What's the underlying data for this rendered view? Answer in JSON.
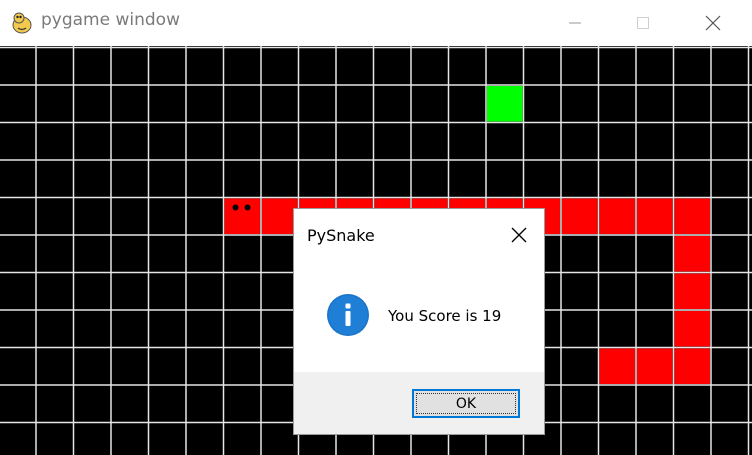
{
  "window": {
    "title": "pygame window",
    "icon": "pygame-snake-icon",
    "controls": [
      "minimize-icon",
      "maximize-icon",
      "close-icon"
    ]
  },
  "game": {
    "columns": 20,
    "rows": 11,
    "background": "#000000",
    "grid_color": "#e6e6e6",
    "snake_color": "#ff0000",
    "food_color": "#00ff00",
    "food": [
      13,
      1
    ],
    "snake_head": [
      6,
      4
    ],
    "snake_body": [
      [
        7,
        4
      ],
      [
        8,
        4
      ],
      [
        9,
        4
      ],
      [
        10,
        4
      ],
      [
        11,
        4
      ],
      [
        12,
        4
      ],
      [
        13,
        4
      ],
      [
        14,
        4
      ],
      [
        15,
        4
      ],
      [
        16,
        4
      ],
      [
        17,
        4
      ],
      [
        18,
        4
      ],
      [
        18,
        5
      ],
      [
        18,
        6
      ],
      [
        18,
        7
      ],
      [
        18,
        8
      ],
      [
        17,
        8
      ],
      [
        16,
        8
      ]
    ]
  },
  "dialog": {
    "title": "PySnake",
    "icon": "info-icon",
    "message": "You Score is 19",
    "ok_label": "OK",
    "accent": "#0078d7"
  }
}
